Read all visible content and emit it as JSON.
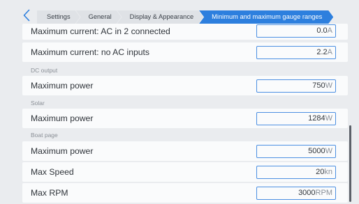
{
  "breadcrumb": [
    "Settings",
    "General",
    "Display & Appearance",
    "Minimum and maximum gauge ranges"
  ],
  "rows": [
    {
      "label": "Maximum current: AC in 2 connected",
      "value": "0.0",
      "unit": "A"
    },
    {
      "label": "Maximum current: no AC inputs",
      "value": "2.2",
      "unit": "A"
    },
    {
      "label": "Maximum power",
      "value": "750",
      "unit": "W"
    },
    {
      "label": "Maximum power",
      "value": "1284",
      "unit": "W"
    },
    {
      "label": "Maximum power",
      "value": "5000",
      "unit": "W"
    },
    {
      "label": "Max Speed",
      "value": "20",
      "unit": "kn"
    },
    {
      "label": "Max RPM",
      "value": "3000",
      "unit": "RPM"
    }
  ],
  "sections": {
    "dc_output": "DC output",
    "solar": "Solar",
    "boat_page": "Boat page"
  },
  "colors": {
    "accent": "#2d7fde",
    "input_border": "#4b8fe2",
    "background": "#eaecef",
    "row_background": "#fafbfc"
  },
  "icons": {
    "back": "chevron-left-icon"
  }
}
